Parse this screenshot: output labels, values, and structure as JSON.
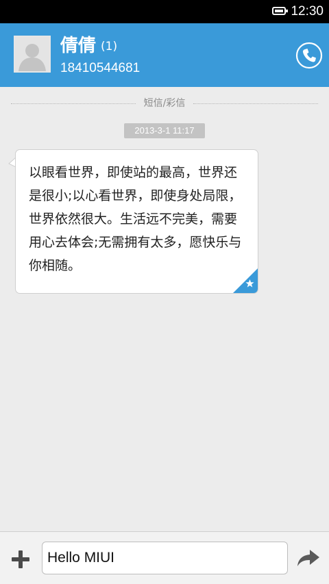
{
  "status_bar": {
    "time": "12:30"
  },
  "header": {
    "contact_name": "倩倩",
    "unread_count": "(1)",
    "phone_number": "18410544681"
  },
  "thread": {
    "divider_label": "短信/彩信",
    "timestamp": "2013-3-1 11:17",
    "messages": [
      {
        "text": "以眼看世界，即使站的最高，世界还是很小;以心看世界，即使身处局限，世界依然很大。生活远不完美，需要用心去体会;无需拥有太多，愿快乐与你相随。"
      }
    ]
  },
  "composer": {
    "input_value": "Hello MIUI"
  },
  "colors": {
    "accent": "#3a9ad9",
    "background": "#ececec",
    "timestamp_bg": "#c3c3c3"
  },
  "icons": {
    "call": "phone-icon",
    "add": "plus-icon",
    "send": "send-arrow-icon",
    "avatar": "default-avatar-icon",
    "favorite": "star-icon"
  }
}
